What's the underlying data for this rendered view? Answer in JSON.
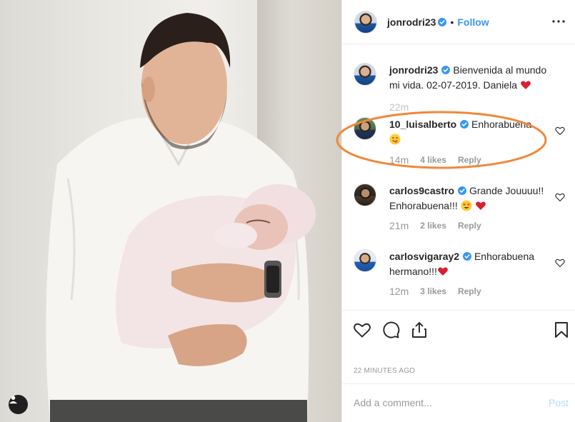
{
  "post": {
    "author": "jonrodri23",
    "follow_label": "Follow",
    "separator": "•",
    "timestamp": "22 MINUTES AGO"
  },
  "caption": {
    "username": "jonrodri23",
    "text": "Bienvenida al mundo mi vida. 02-07-2019. Daniela",
    "time": "22m"
  },
  "comments": [
    {
      "username": "10_luisalberto",
      "text": "Enhorabuena",
      "emoji": "wink-tongue-emoji",
      "time": "14m",
      "likes": "4 likes",
      "reply": "Reply"
    },
    {
      "username": "carlos9castro",
      "text": "Grande Jouuuu!! Enhorabuena!!!",
      "emoji": "star-eyes-emoji",
      "time": "21m",
      "likes": "2 likes",
      "reply": "Reply"
    },
    {
      "username": "carlosvigaray2",
      "text": "Enhorabuena hermano!!!",
      "emoji": "red-heart-emoji",
      "time": "12m",
      "likes": "3 likes",
      "reply": "Reply"
    }
  ],
  "add_comment": {
    "placeholder": "Add a comment...",
    "post_label": "Post"
  },
  "icons": {
    "verified": "verified-badge-icon",
    "more": "more-options-icon",
    "like": "heart-icon",
    "comment": "comment-icon",
    "share": "share-icon",
    "save": "bookmark-icon",
    "user_tag": "user-tag-icon"
  },
  "colors": {
    "link": "#3897f0",
    "verified": "#3897f0",
    "highlight_ring": "#f0883a",
    "heart": "#ed4956"
  }
}
